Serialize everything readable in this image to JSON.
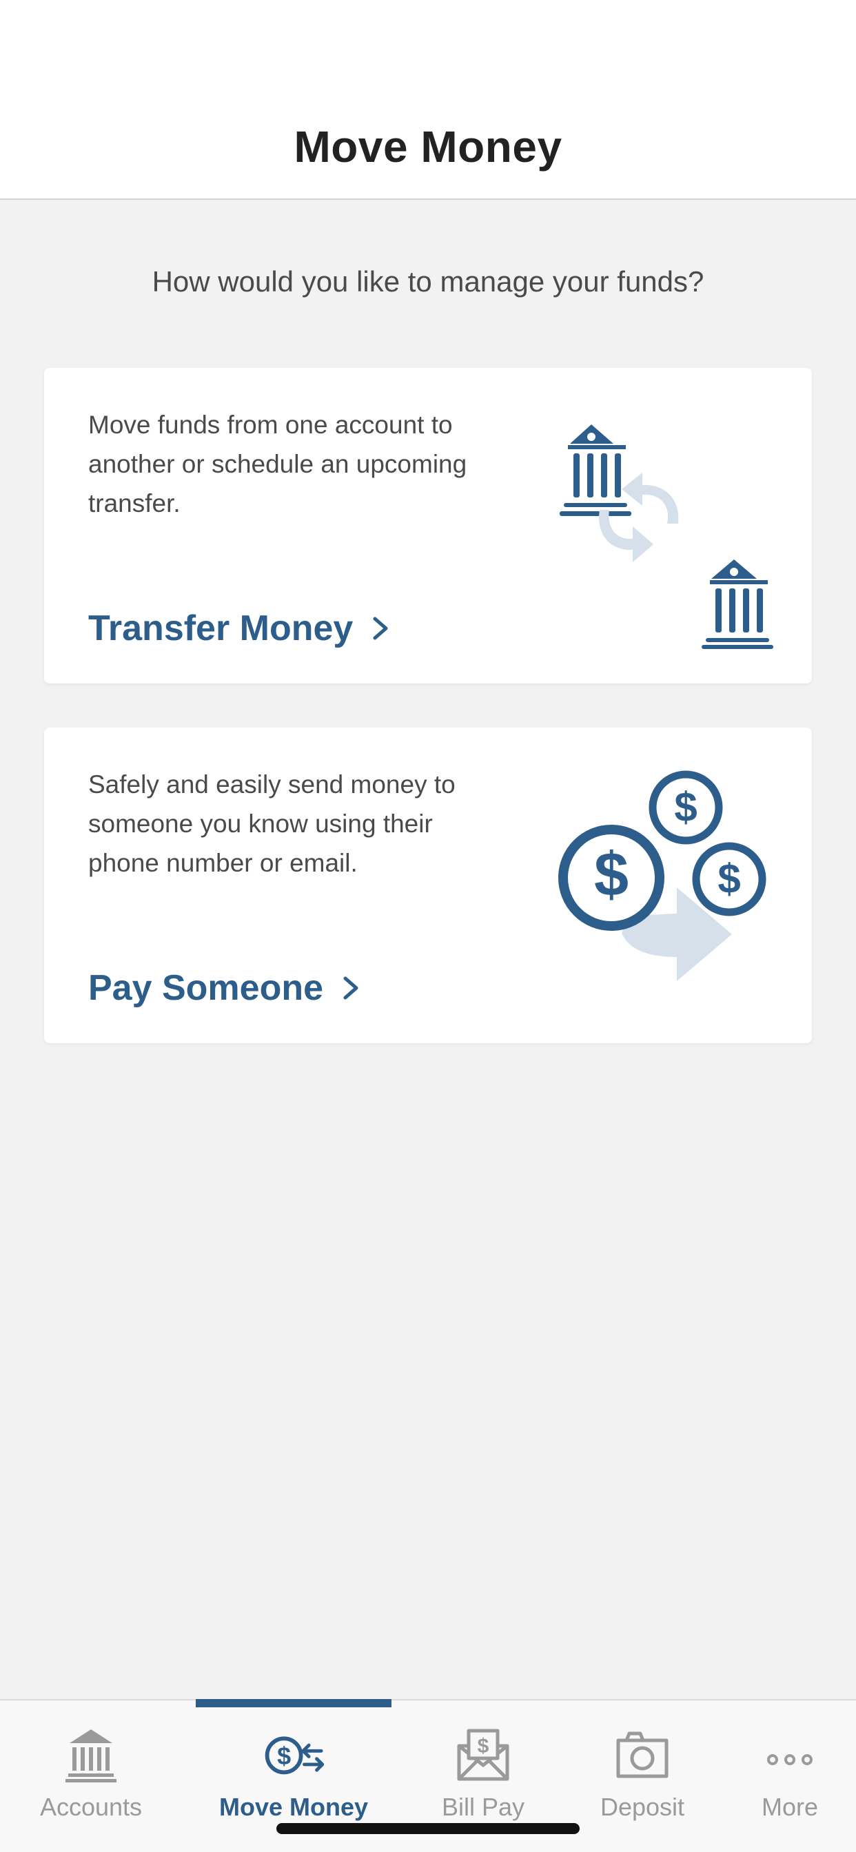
{
  "header": {
    "title": "Move Money"
  },
  "prompt": "How would you like to manage your funds?",
  "cards": [
    {
      "description": "Move funds from one account to another or schedule an upcoming transfer.",
      "link_label": "Transfer Money",
      "icon": "bank-transfer-icon"
    },
    {
      "description": "Safely and easily send money to someone you know using their phone number or email.",
      "link_label": "Pay Someone",
      "icon": "coins-send-icon"
    }
  ],
  "tabbar": {
    "active": "Move Money",
    "items": [
      {
        "label": "Accounts",
        "icon": "bank-icon"
      },
      {
        "label": "Move Money",
        "icon": "dollar-transfer-icon"
      },
      {
        "label": "Bill Pay",
        "icon": "envelope-dollar-icon"
      },
      {
        "label": "Deposit",
        "icon": "camera-icon"
      },
      {
        "label": "More",
        "icon": "more-dots-icon"
      }
    ]
  },
  "colors": {
    "accent": "#2d5d8a",
    "accent_light": "#d6e0ea",
    "background": "#f2f2f2",
    "inactive": "#9a9a9a"
  }
}
